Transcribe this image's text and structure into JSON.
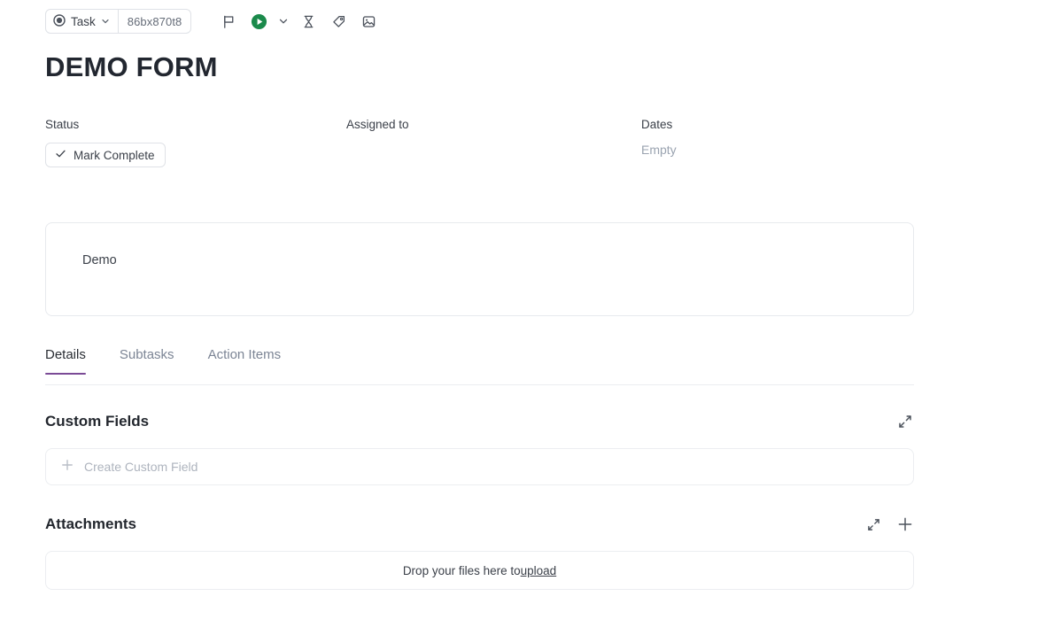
{
  "toolbar": {
    "type_icon": "target-icon",
    "type_label": "Task",
    "type_chevron": "chevron-down-icon",
    "task_id": "86bx870t8",
    "icons": [
      {
        "name": "flag-icon",
        "label": "Flag"
      },
      {
        "name": "play-circle-icon",
        "label": "Start timer"
      },
      {
        "name": "chevron-down-icon",
        "label": "Timer options"
      },
      {
        "name": "hourglass-icon",
        "label": "Time estimate"
      },
      {
        "name": "tag-icon",
        "label": "Tags"
      },
      {
        "name": "image-icon",
        "label": "Cover image"
      }
    ],
    "accent_green": "#1b8a4b"
  },
  "page": {
    "title": "DEMO FORM"
  },
  "meta": {
    "status": {
      "label": "Status",
      "button_label": "Mark Complete",
      "check_icon": "check-icon"
    },
    "assigned": {
      "label": "Assigned to",
      "value": ""
    },
    "dates": {
      "label": "Dates",
      "value": "Empty"
    }
  },
  "description": {
    "text": "Demo"
  },
  "tabs": {
    "active_color": "#7b4b96",
    "items": [
      {
        "label": "Details",
        "active": true
      },
      {
        "label": "Subtasks",
        "active": false
      },
      {
        "label": "Action Items",
        "active": false
      }
    ]
  },
  "custom_fields": {
    "title": "Custom Fields",
    "expand_icon": "expand-icon",
    "create_label": "Create Custom Field",
    "create_icon": "plus-icon"
  },
  "attachments": {
    "title": "Attachments",
    "expand_icon": "expand-icon",
    "add_icon": "plus-icon",
    "dropzone_text": "Drop your files here to ",
    "dropzone_link": "upload"
  }
}
